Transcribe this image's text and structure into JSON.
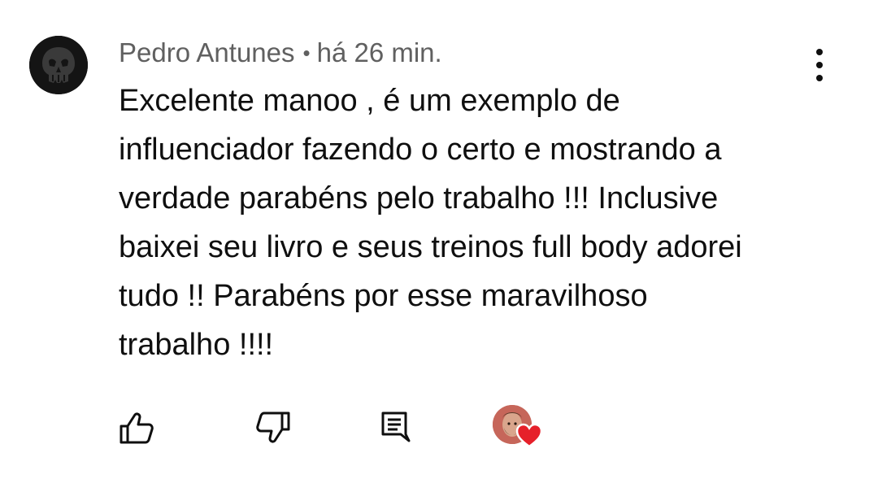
{
  "comment": {
    "author": "Pedro Antunes",
    "separator": "•",
    "time": "há 26 min.",
    "text": "Excelente manoo , é um exemplo de\ninfluenciador fazendo o certo e mostrando a\nverdade parabéns pelo trabalho !!! Inclusive\nbaixei seu livro e seus treinos full body adorei\ntudo !! Parabéns por esse maravilhoso\ntrabalho !!!!"
  },
  "icons": {
    "avatar": "punisher-skull-avatar",
    "menu": "more-vert-icon",
    "like": "thumb-up-icon",
    "dislike": "thumb-down-icon",
    "reply": "reply-comment-icon",
    "creator_heart": "creator-heart-icon"
  },
  "colors": {
    "meta_text": "#606060",
    "body_text": "#0f0f0f",
    "heart": "#e6202a"
  }
}
